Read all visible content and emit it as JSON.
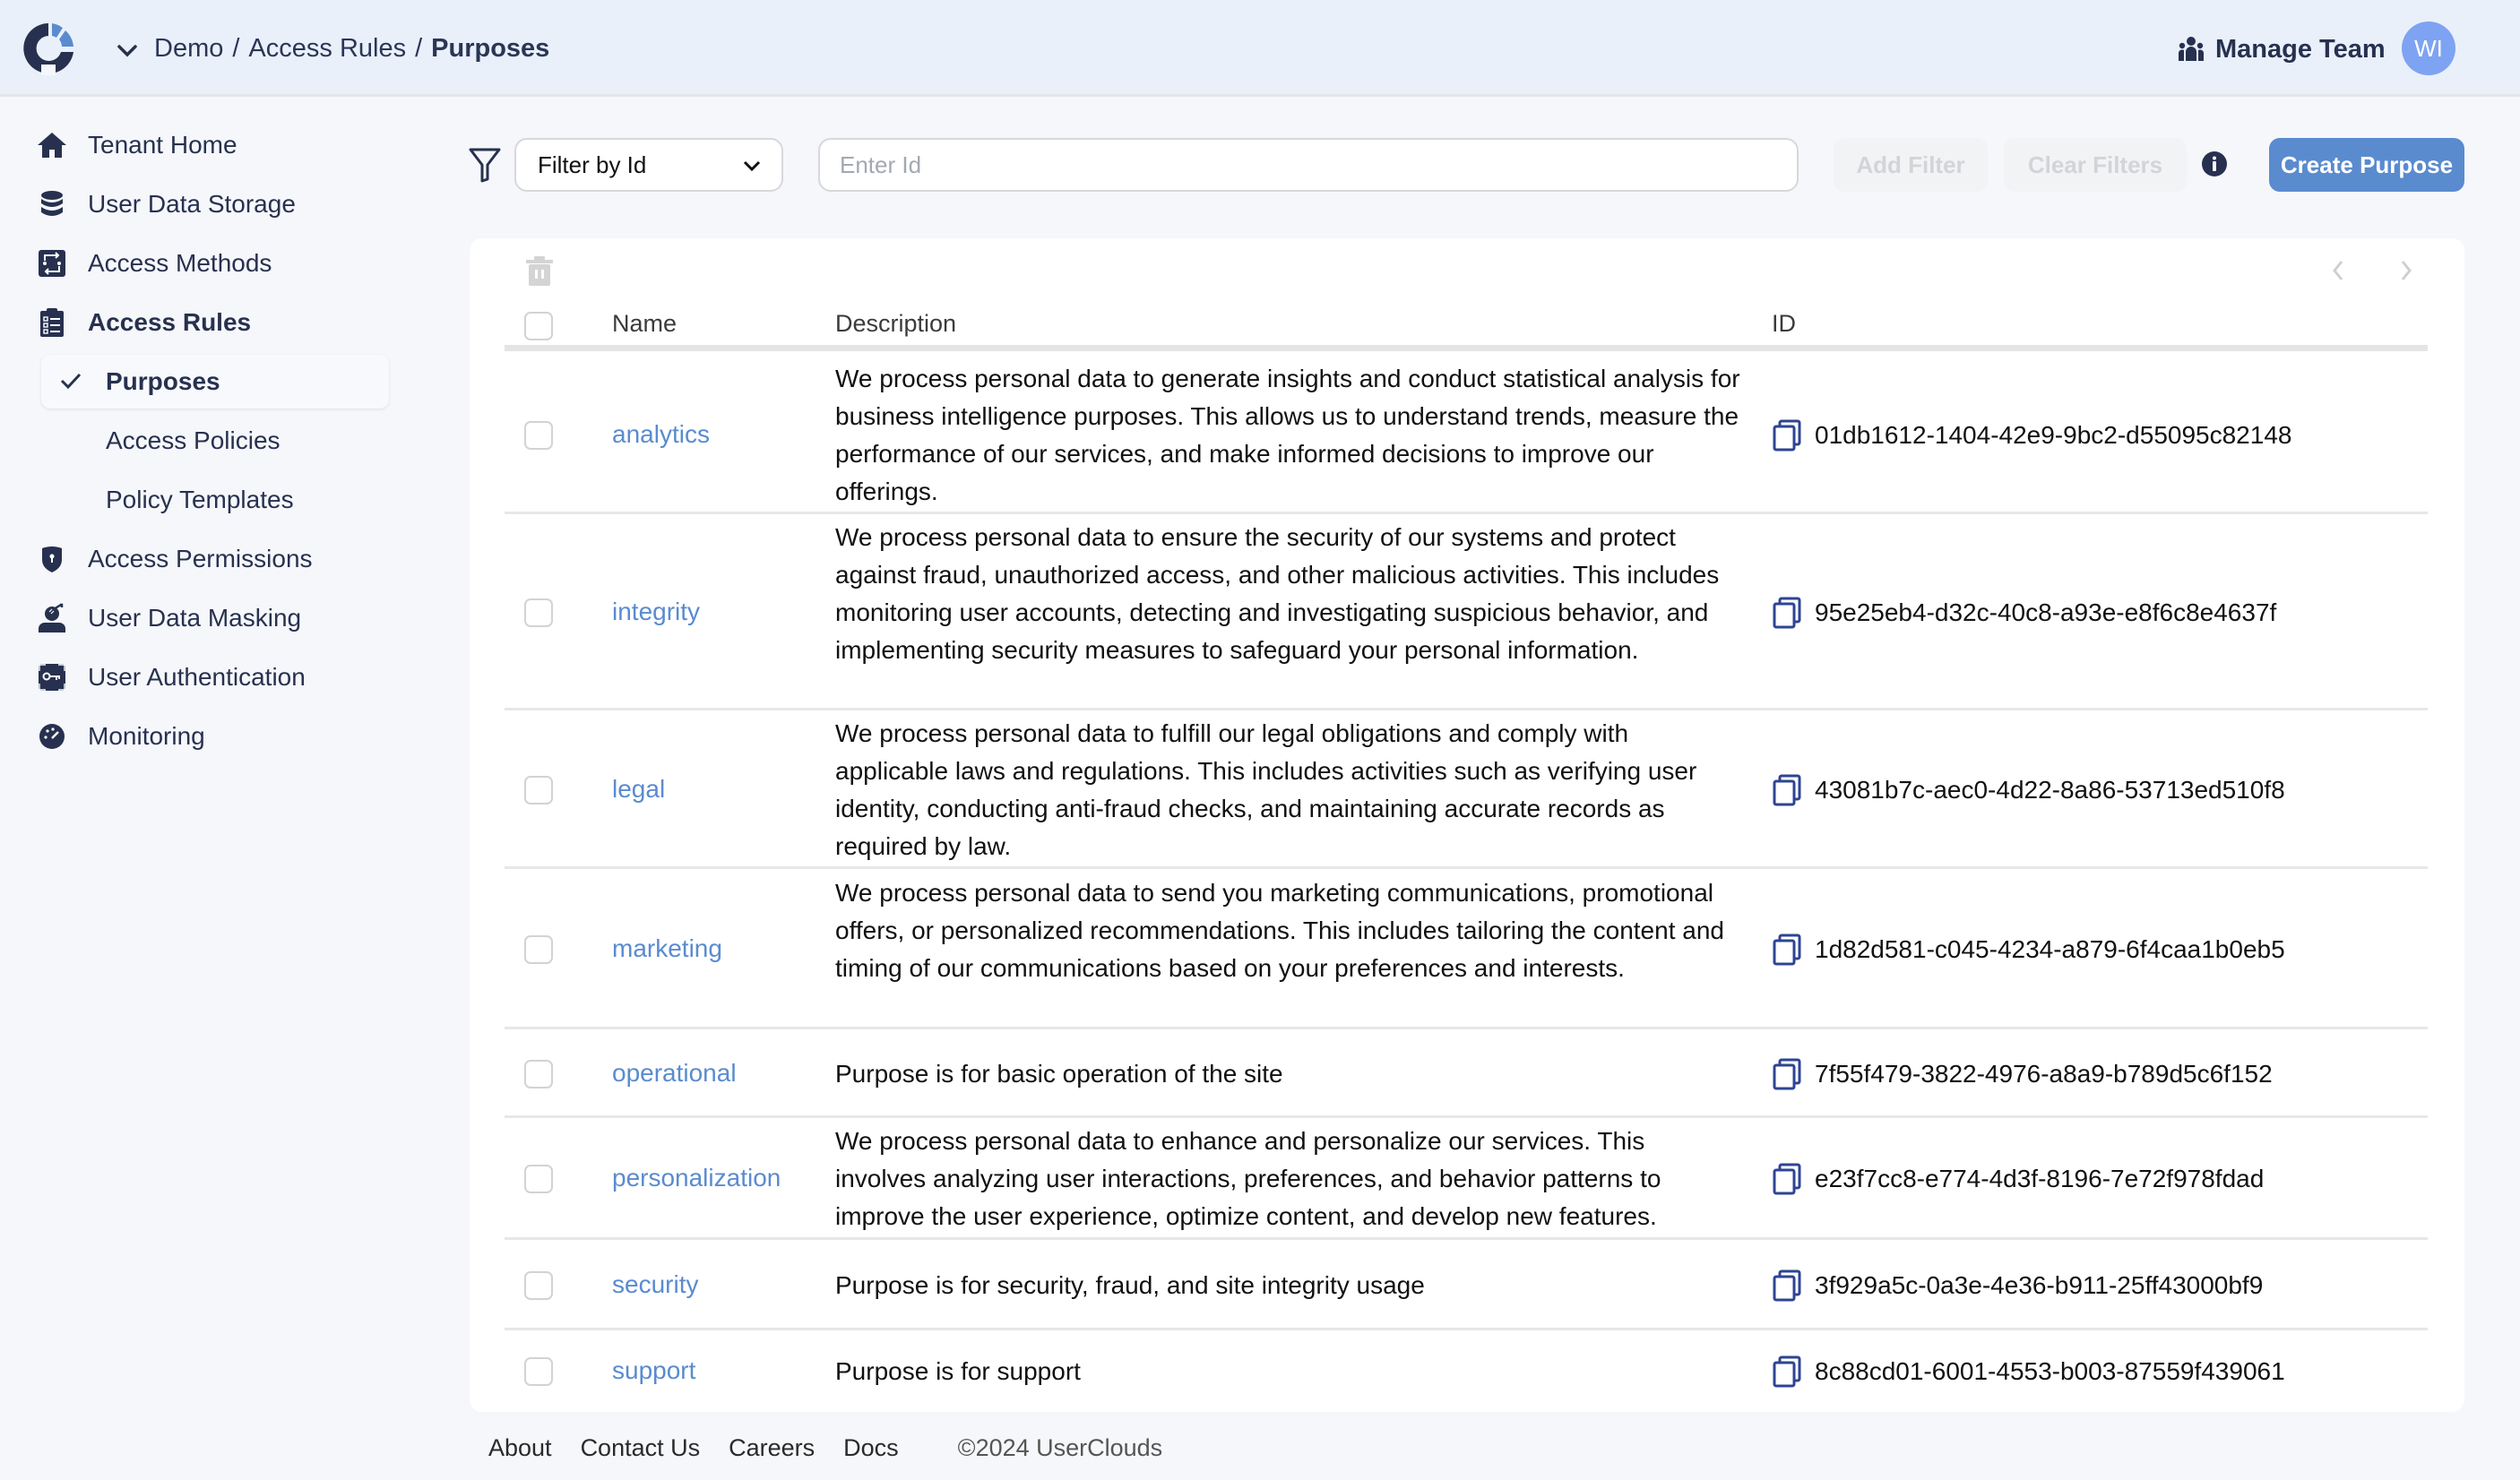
{
  "header": {
    "breadcrumb": [
      "Demo",
      "Access Rules",
      "Purposes"
    ],
    "separator": "/",
    "manage_team": "Manage Team",
    "avatar_initials": "WI"
  },
  "sidebar": {
    "items": [
      {
        "label": "Tenant Home",
        "icon": "home-icon"
      },
      {
        "label": "User Data Storage",
        "icon": "database-icon"
      },
      {
        "label": "Access Methods",
        "icon": "access-methods-icon"
      },
      {
        "label": "Access Rules",
        "icon": "clipboard-list-icon",
        "expanded": true
      },
      {
        "label": "Access Permissions",
        "icon": "shield-icon"
      },
      {
        "label": "User Data Masking",
        "icon": "user-mask-icon"
      },
      {
        "label": "User Authentication",
        "icon": "key-icon"
      },
      {
        "label": "Monitoring",
        "icon": "gauge-icon"
      }
    ],
    "sub_items": [
      {
        "label": "Purposes",
        "active": true
      },
      {
        "label": "Access Policies",
        "active": false
      },
      {
        "label": "Policy Templates",
        "active": false
      }
    ]
  },
  "toolbar": {
    "filter_select_value": "Filter by Id",
    "id_input_placeholder": "Enter Id",
    "id_input_value": "",
    "add_filter": "Add Filter",
    "clear_filters": "Clear Filters",
    "create_button": "Create Purpose"
  },
  "table": {
    "columns": [
      "Name",
      "Description",
      "ID"
    ],
    "rows": [
      {
        "name": "analytics",
        "description": "We process personal data to generate insights and conduct statistical analysis for business intelligence purposes. This allows us to understand trends, measure the performance of our services, and make informed decisions to improve our offerings.",
        "id": "01db1612-1404-42e9-9bc2-d55095c82148"
      },
      {
        "name": "integrity",
        "description": "We process personal data to ensure the security of our systems and protect against fraud, unauthorized access, and other malicious activities. This includes monitoring user accounts, detecting and investigating suspicious behavior, and implementing security measures to safeguard your personal information.",
        "id": "95e25eb4-d32c-40c8-a93e-e8f6c8e4637f"
      },
      {
        "name": "legal",
        "description": "We process personal data to fulfill our legal obligations and comply with applicable laws and regulations. This includes activities such as verifying user identity, conducting anti-fraud checks, and maintaining accurate records as required by law.",
        "id": "43081b7c-aec0-4d22-8a86-53713ed510f8"
      },
      {
        "name": "marketing",
        "description": "We process personal data to send you marketing communications, promotional offers, or personalized recommendations. This includes tailoring the content and timing of our communications based on your preferences and interests.",
        "id": "1d82d581-c045-4234-a879-6f4caa1b0eb5"
      },
      {
        "name": "operational",
        "description": "Purpose is for basic operation of the site",
        "id": "7f55f479-3822-4976-a8a9-b789d5c6f152"
      },
      {
        "name": "personalization",
        "description": "We process personal data to enhance and personalize our services. This involves analyzing user interactions, preferences, and behavior patterns to improve the user experience, optimize content, and develop new features.",
        "id": "e23f7cc8-e774-4d3f-8196-7e72f978fdad"
      },
      {
        "name": "security",
        "description": "Purpose is for security, fraud, and site integrity usage",
        "id": "3f929a5c-0a3e-4e36-b911-25ff43000bf9"
      },
      {
        "name": "support",
        "description": "Purpose is for support",
        "id": "8c88cd01-6001-4553-b003-87559f439061"
      }
    ]
  },
  "footer": {
    "links": [
      "About",
      "Contact Us",
      "Careers",
      "Docs"
    ],
    "copyright": "©2024 UserClouds"
  },
  "colors": {
    "accent": "#5a8bcf",
    "header_bg": "#e9f0fa",
    "page_bg": "#f6f7fb",
    "nav_text": "#27314f",
    "avatar_bg": "#7ea3f2",
    "copy_icon": "#2e4494"
  }
}
